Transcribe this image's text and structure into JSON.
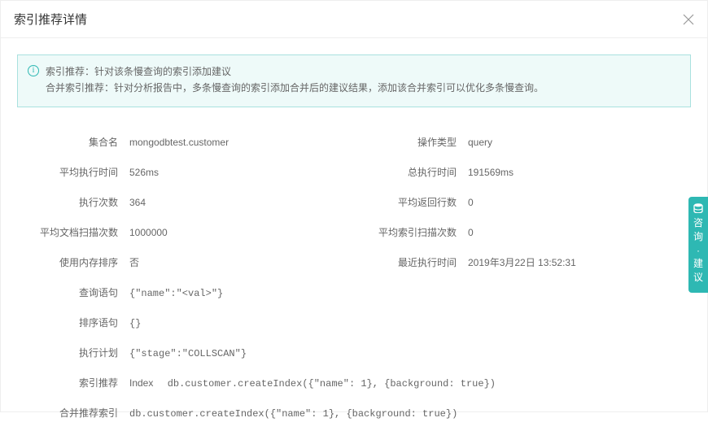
{
  "modal": {
    "title": "索引推荐详情",
    "info": {
      "line1": "索引推荐：针对该条慢查询的索引添加建议",
      "line2": "合并索引推荐：针对分析报告中，多条慢查询的索引添加合并后的建议结果，添加该合并索引可以优化多条慢查询。"
    }
  },
  "fields": {
    "pairs": [
      {
        "l_label": "集合名",
        "l_value": "mongodbtest.customer",
        "r_label": "操作类型",
        "r_value": "query"
      },
      {
        "l_label": "平均执行时间",
        "l_value": "526ms",
        "r_label": "总执行时间",
        "r_value": "191569ms"
      },
      {
        "l_label": "执行次数",
        "l_value": "364",
        "r_label": "平均返回行数",
        "r_value": "0"
      },
      {
        "l_label": "平均文档扫描次数",
        "l_value": "1000000",
        "r_label": "平均索引扫描次数",
        "r_value": "0"
      },
      {
        "l_label": "使用内存排序",
        "l_value": "否",
        "r_label": "最近执行时间",
        "r_value": "2019年3月22日 13:52:31"
      }
    ],
    "long": [
      {
        "label": "查询语句",
        "value": "{\"name\":\"<val>\"}"
      },
      {
        "label": "排序语句",
        "value": "{}"
      },
      {
        "label": "执行计划",
        "value": "{\"stage\":\"COLLSCAN\"}"
      },
      {
        "label": "索引推荐",
        "prefix": "Index",
        "value": "db.customer.createIndex({\"name\": 1}, {background: true})"
      },
      {
        "label": "合并推荐索引",
        "value": "db.customer.createIndex({\"name\": 1}, {background: true})"
      }
    ]
  },
  "sideTab": {
    "text": "咨询·建议"
  }
}
